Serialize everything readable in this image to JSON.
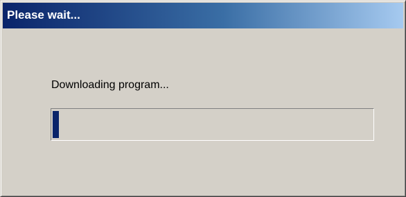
{
  "window": {
    "title": "Please wait..."
  },
  "message": "Downloading program...",
  "progress": {
    "fraction": 0.02,
    "color": "#0a246a"
  },
  "colors": {
    "title_gradient_start": "#0a246a",
    "title_gradient_end": "#a6caf0",
    "dialog_background": "#d4d0c8"
  }
}
